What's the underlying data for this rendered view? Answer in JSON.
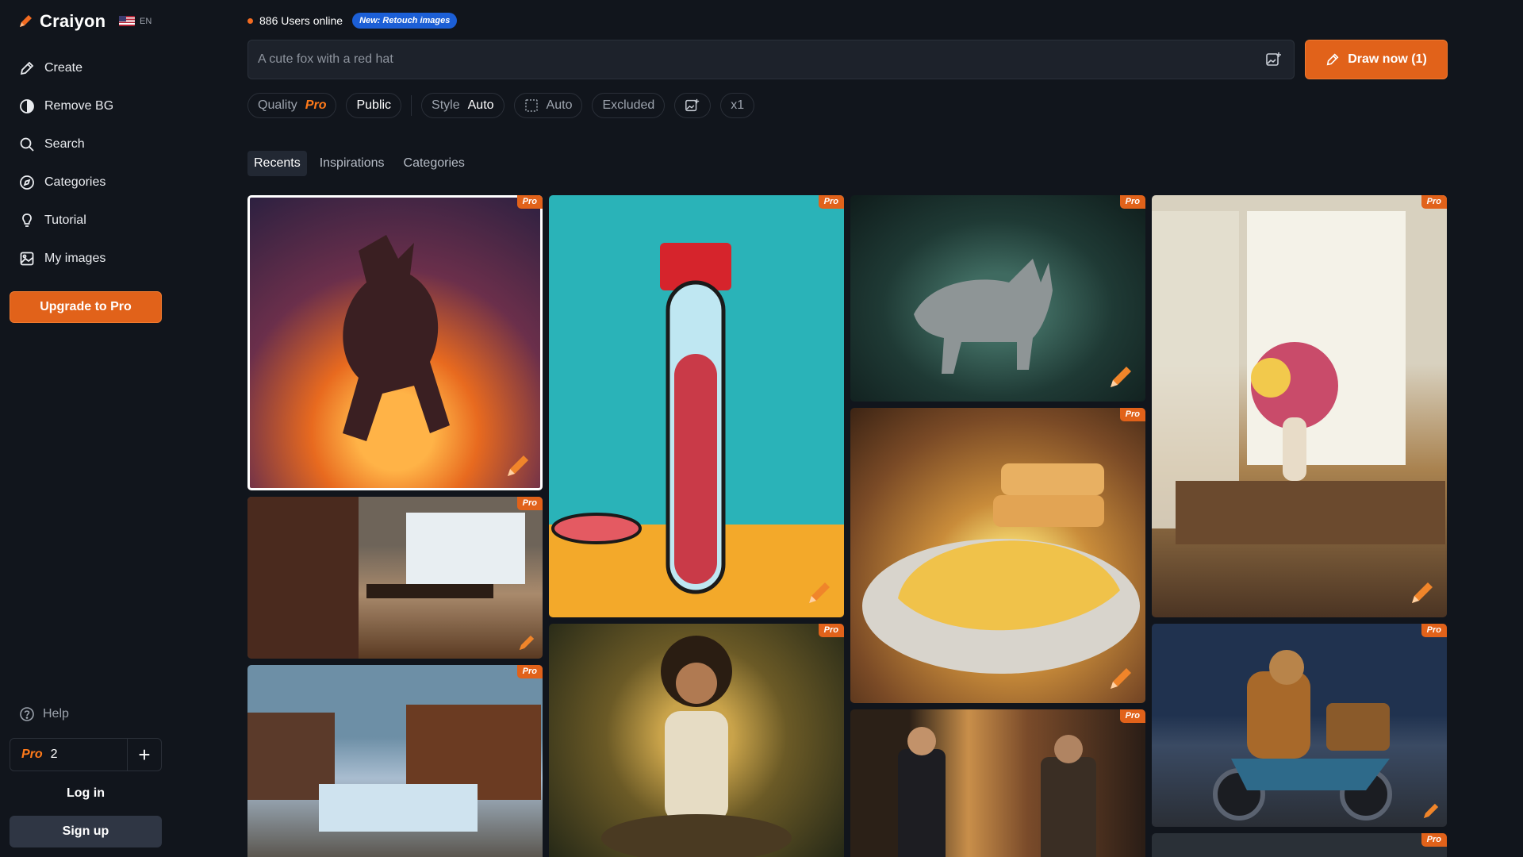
{
  "app": {
    "name": "Craiyon",
    "lang": "EN"
  },
  "sidebar": {
    "items": [
      {
        "label": "Create",
        "icon": "pencil-icon"
      },
      {
        "label": "Remove BG",
        "icon": "half-circle-icon"
      },
      {
        "label": "Search",
        "icon": "search-icon"
      },
      {
        "label": "Categories",
        "icon": "compass-icon"
      },
      {
        "label": "Tutorial",
        "icon": "lightbulb-icon"
      },
      {
        "label": "My images",
        "icon": "image-icon"
      }
    ],
    "upgrade_label": "Upgrade to Pro",
    "help_label": "Help",
    "credits": {
      "tier": "Pro",
      "count": "2"
    },
    "login_label": "Log in",
    "signup_label": "Sign up"
  },
  "topbar": {
    "online_text": "886 Users online",
    "new_badge": "New: Retouch images"
  },
  "prompt": {
    "placeholder": "A cute fox with a red hat",
    "draw_label": "Draw now (1)"
  },
  "options": {
    "quality_label": "Quality",
    "quality_value": "Pro",
    "visibility": "Public",
    "style_label": "Style",
    "style_value": "Auto",
    "ratio_value": "Auto",
    "excluded_label": "Excluded",
    "count_label": "x1"
  },
  "tabs": [
    {
      "label": "Recents",
      "active": true
    },
    {
      "label": "Inspirations",
      "active": false
    },
    {
      "label": "Categories",
      "active": false
    }
  ],
  "gallery": {
    "badge_label": "Pro",
    "images": [
      {
        "name": "image-monster-sunset"
      },
      {
        "name": "image-test-tube-lab"
      },
      {
        "name": "image-wolf-forest"
      },
      {
        "name": "image-window-flowers"
      },
      {
        "name": "image-office-room"
      },
      {
        "name": "image-omelette-toast"
      },
      {
        "name": "image-winter-market"
      },
      {
        "name": "image-meditating-man"
      },
      {
        "name": "image-street-men"
      },
      {
        "name": "image-scooter-delivery"
      },
      {
        "name": "image-bottom-partial"
      }
    ]
  },
  "colors": {
    "accent": "#e1621a",
    "bg": "#11151c",
    "badge_blue": "#1c5fd6"
  }
}
